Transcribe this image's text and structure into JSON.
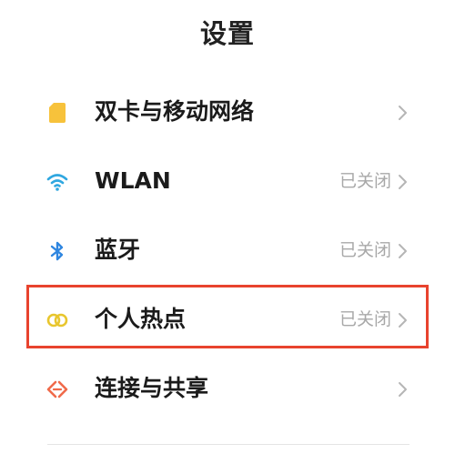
{
  "header": {
    "title": "设置"
  },
  "settings": {
    "items": [
      {
        "label": "双卡与移动网络",
        "status": "",
        "icon": "sim-card-icon",
        "icon_color": "#F7C23B"
      },
      {
        "label": "WLAN",
        "status": "已关闭",
        "icon": "wifi-icon",
        "icon_color": "#2FA7E0"
      },
      {
        "label": "蓝牙",
        "status": "已关闭",
        "icon": "bluetooth-icon",
        "icon_color": "#2F86E0"
      },
      {
        "label": "个人热点",
        "status": "已关闭",
        "icon": "hotspot-icon",
        "icon_color": "#E8C62E"
      },
      {
        "label": "连接与共享",
        "status": "",
        "icon": "connection-share-icon",
        "icon_color": "#F06A4A"
      }
    ]
  },
  "highlight": {
    "target": "个人热点",
    "color": "#E8432E"
  },
  "colors": {
    "status_text": "#A8A8A8",
    "chevron": "#B5B5B5",
    "label_text": "#1B1B1B"
  }
}
